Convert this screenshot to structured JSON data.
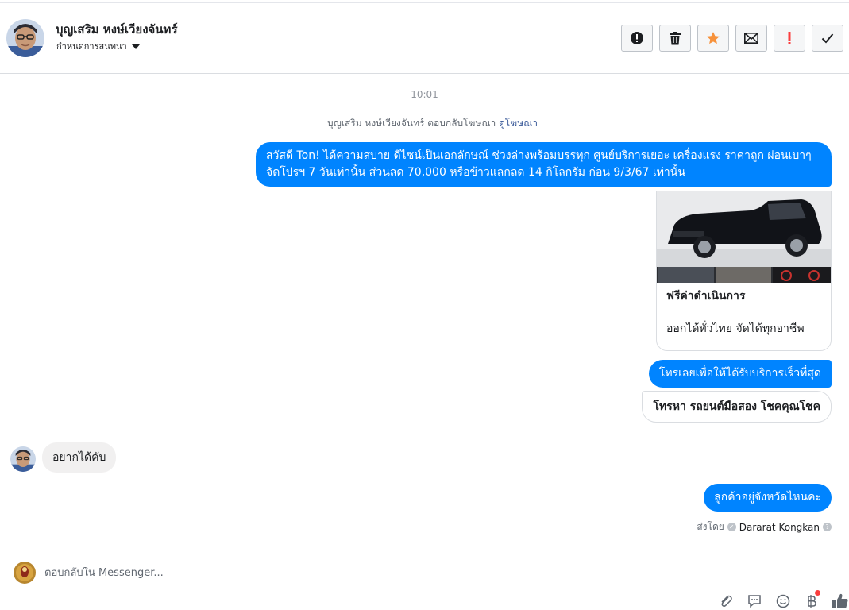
{
  "header": {
    "name": "บุญเสริม หงษ์เวียงจันทร์",
    "assign_label": "กำหนดการสนทนา",
    "actions": [
      "mark-spam",
      "delete",
      "star",
      "mark-unread",
      "important",
      "done"
    ]
  },
  "conversation": {
    "time": "10:01",
    "replied_prefix": "บุญเสริม หงษ์เวียงจันทร์ ตอบกลับโฆษณา",
    "view_ad_link": "ดูโฆษณา",
    "outgoing_ad_text": "สวัสดี Ton! ได้ความสบาย ดีไซน์เป็นเอกลักษณ์ ช่วงล่างพร้อมบรรทุก ศูนย์บริการเยอะ เครื่องแรง ราคาถูก ผ่อนเบาๆ จัดโปรฯ 7 วันเท่านั้น ส่วนลด 70,000 หรือข้าวแลกลด 14 กิโลกรัม ก่อน 9/3/67 เท่านั้น",
    "card": {
      "title": "ฟรีค่าดำเนินการ",
      "description": "ออกได้ทั่วไทย จัดได้ทุกอาชีพ"
    },
    "outgoing_call": "โทรเลยเพื่อให้ได้รับบริการเร็วที่สุด",
    "quick_reply": "โทรหา รถยนต์มือสอง โชคคุณโชค",
    "incoming": "อยากได้คับ",
    "outgoing_last": "ลูกค้าอยู่จังหวัดไหนคะ",
    "sent_by_label": "ส่งโดย",
    "sent_by_name": "Dararat Kongkan"
  },
  "composer": {
    "placeholder": "ตอบกลับใน Messenger..."
  },
  "colors": {
    "accent": "#0084ff",
    "star": "#f7923b",
    "important": "#fa3e3e"
  }
}
